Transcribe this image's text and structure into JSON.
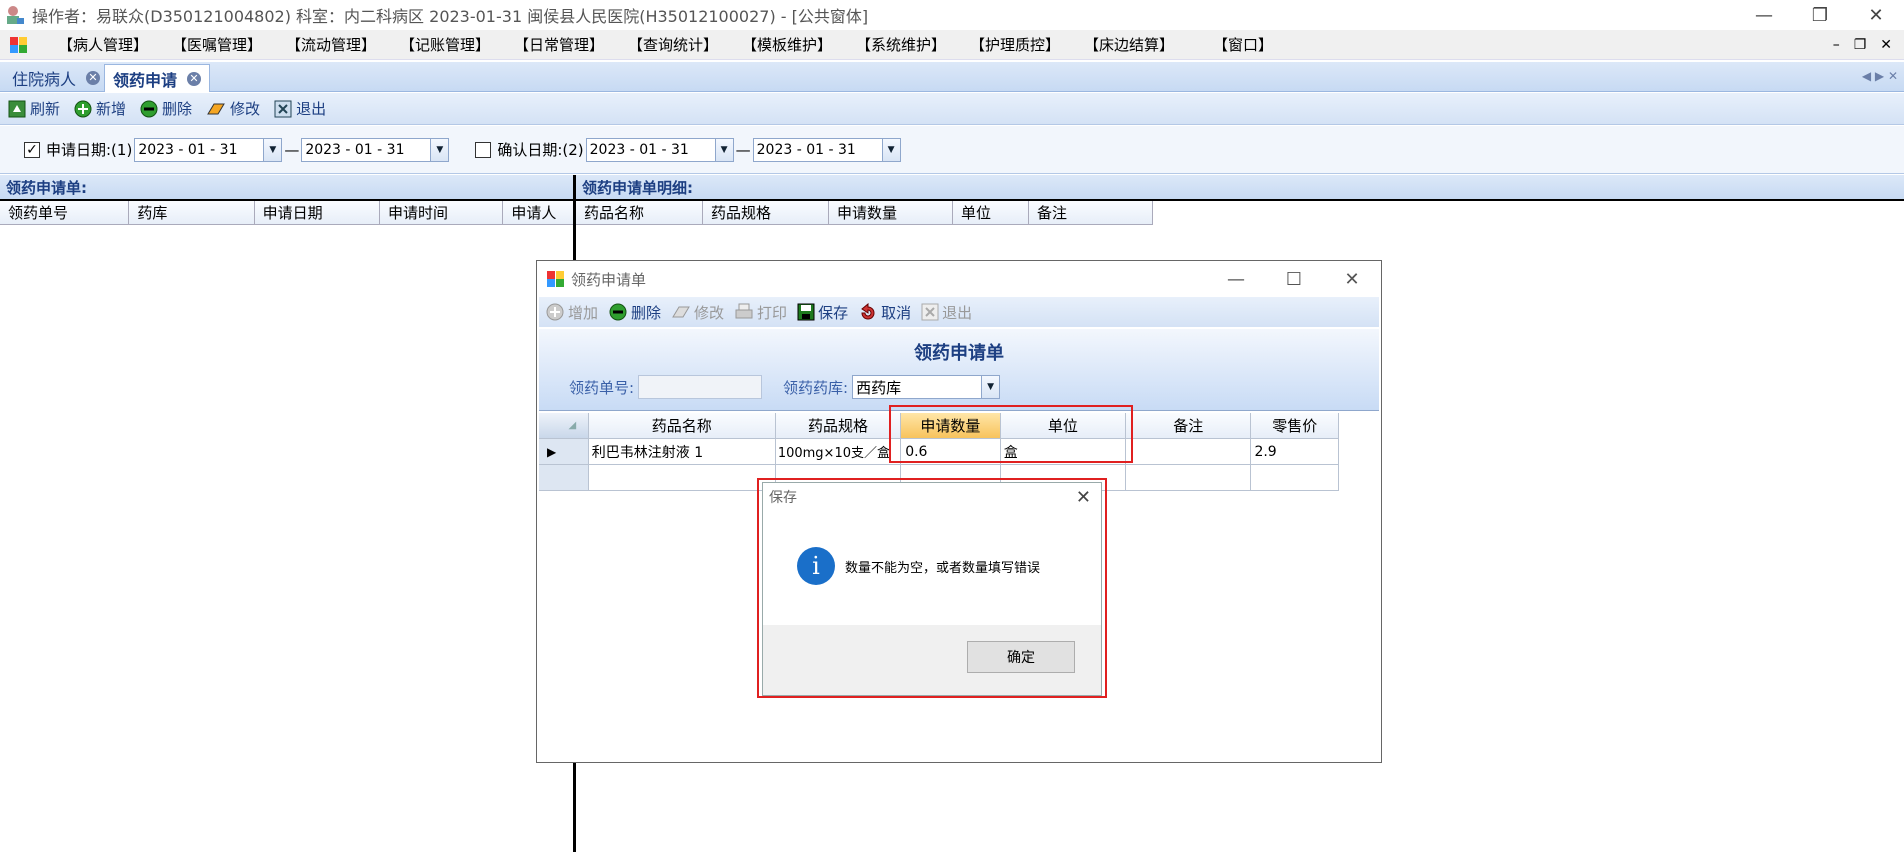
{
  "window": {
    "title": "操作者：易联众(D350121004802)  科室：内二科病区  2023-01-31  闽侯县人民医院(H35012100027) - [公共窗体]"
  },
  "menu": [
    "【病人管理】",
    "【医嘱管理】",
    "【流动管理】",
    "【记账管理】",
    "【日常管理】",
    "【查询统计】",
    "【模板维护】",
    "【系统维护】",
    "【护理质控】",
    "【床边结算】",
    "【窗口】"
  ],
  "tabs": [
    "住院病人",
    "领药申请"
  ],
  "toolbar": {
    "refresh": "刷新",
    "add": "新增",
    "delete": "删除",
    "edit": "修改",
    "exit": "退出"
  },
  "filter": {
    "apply_label": "申请日期:(1)",
    "apply_from": "2023 - 01 - 31",
    "apply_to": "2023 - 01 - 31",
    "confirm_label": "确认日期:(2)",
    "confirm_from": "2023 - 01 - 31",
    "confirm_to": "2023 - 01 - 31",
    "sep": "—"
  },
  "left_panel": {
    "title": "领药申请单:",
    "columns": [
      "领药单号",
      "药库",
      "申请日期",
      "申请时间",
      "申请人"
    ]
  },
  "right_panel": {
    "title": "领药申请单明细:",
    "columns": [
      "药品名称",
      "药品规格",
      "申请数量",
      "单位",
      "备注"
    ]
  },
  "dialog": {
    "title": "领药申请单",
    "toolbar": {
      "add": "增加",
      "delete": "删除",
      "edit": "修改",
      "print": "打印",
      "save": "保存",
      "cancel": "取消",
      "exit": "退出"
    },
    "heading": "领药申请单",
    "order_no_label": "领药单号:",
    "order_no_value": "",
    "pharmacy_label": "领药药库:",
    "pharmacy_value": "西药库",
    "columns": [
      "药品名称",
      "药品规格",
      "申请数量",
      "单位",
      "备注",
      "零售价"
    ],
    "rows": [
      {
        "name": "利巴韦林注射液 1",
        "spec": "100mg×10支／盒",
        "qty": "0.6",
        "unit": "盒",
        "note": "",
        "price": "2.9"
      }
    ]
  },
  "messagebox": {
    "title": "保存",
    "text": "数量不能为空，或者数量填写错误",
    "ok": "确定",
    "info_glyph": "i"
  }
}
